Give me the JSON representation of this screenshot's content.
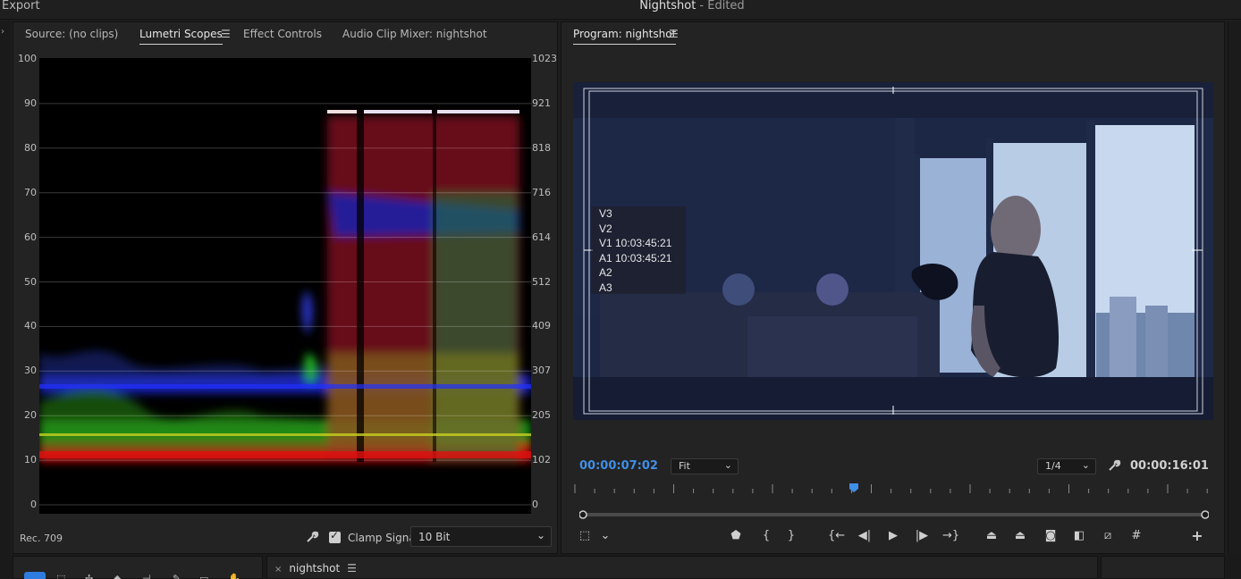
{
  "title_bar": {
    "menu_left": "Export",
    "project": "Nightshot",
    "status": " - Edited"
  },
  "source_panel": {
    "tabs": [
      {
        "label": "Source: (no clips)",
        "active": false
      },
      {
        "label": "Lumetri Scopes",
        "active": true
      },
      {
        "label": "Effect Controls",
        "active": false
      },
      {
        "label": "Audio Clip Mixer: nightshot",
        "active": false
      }
    ],
    "scope": {
      "left_axis": [
        "100",
        "90",
        "80",
        "70",
        "60",
        "50",
        "40",
        "30",
        "20",
        "10",
        "0"
      ],
      "right_axis": [
        "1023",
        "921",
        "818",
        "716",
        "614",
        "512",
        "409",
        "307",
        "205",
        "102",
        "0"
      ]
    },
    "footer": {
      "color_space": "Rec. 709",
      "clamp_label": "Clamp Signal",
      "clamp_checked": true,
      "bit_depth": "10 Bit"
    }
  },
  "program_panel": {
    "title": "Program: nightshot",
    "overlay_lines": [
      "V3",
      "V2",
      "V1 10:03:45:21",
      "A1 10:03:45:21",
      "A2",
      "A3"
    ],
    "current_time": "00:00:07:02",
    "zoom": "Fit",
    "resolution": "1/4",
    "duration": "00:00:16:01"
  },
  "timeline": {
    "sequence_tab": "nightshot"
  },
  "icons": {
    "wrench": "wrench-icon",
    "menu": "hamburger-menu-icon",
    "play": "play-icon",
    "add": "add-button-icon"
  },
  "colors": {
    "accent_timecode": "#3f8fe8",
    "active_tool": "#2d7de0"
  }
}
